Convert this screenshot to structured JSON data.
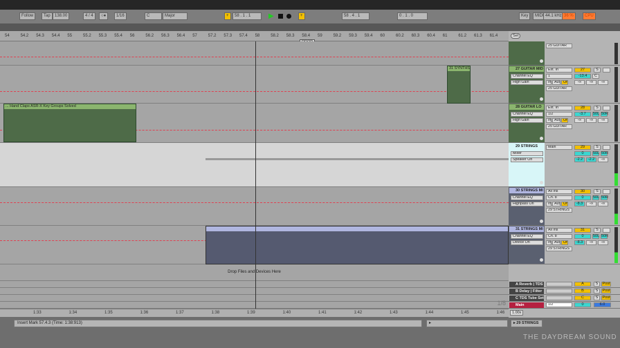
{
  "toolbar": {
    "follow": "Follow",
    "tap": "Tap",
    "tempo": "138.00",
    "signature": "4 / 4",
    "quantize": "1/16",
    "key": "C",
    "scale": "Major",
    "position": "58 .  1 .  1",
    "loop_start": "58 .  4 .  1",
    "loop_length": "0 .  1 .  0",
    "key_map": "Key",
    "midi_map": "MIDI",
    "sample_rate": "44.1 kHz",
    "cpu_percent": "36 %",
    "cpu_label": "CPU"
  },
  "ruler": {
    "ticks": [
      "54",
      "54.2",
      "54.3",
      "54.4",
      "55",
      "55.2",
      "55.3",
      "55.4",
      "56",
      "56.2",
      "56.3",
      "56.4",
      "57",
      "57.2",
      "57.3",
      "57.4",
      "58",
      "58.2",
      "58.3",
      "58.4",
      "59",
      "59.2",
      "59.3",
      "59.4",
      "60",
      "60.2",
      "60.3",
      "60.4",
      "61",
      "61.2",
      "61.3",
      "61.4"
    ],
    "locator": "DROP",
    "set_label": "Set"
  },
  "time_ruler": {
    "ticks": [
      "1:33",
      "1:34",
      "1:35",
      "1:36",
      "1:37",
      "1:38",
      "1:39",
      "1:40",
      "1:41",
      "1:42",
      "1:43",
      "1:44",
      "1:45",
      "1:46"
    ],
    "grid": "1/8"
  },
  "clips": {
    "hand_claps": "... Hand Claps ASR-X Key Groups Solved",
    "synths": "31 SYNTHS 3"
  },
  "drop_hint": "Drop Files and Devices Here",
  "tracks": [
    {
      "name": "",
      "color": "#4e6b48",
      "routing": "25 GUITAR",
      "dev1": "",
      "dev2": ""
    },
    {
      "name": "27 GUITAR MID",
      "color": "#4e6b48",
      "input": "Ext. In",
      "channel": "1",
      "routing": "25 GUITAR",
      "dev1": "Channel EQ",
      "dev2": "High Gain",
      "number": "27",
      "vol": "-13.4",
      "pan": "C",
      "sends": [
        "-∞",
        "-∞",
        "-∞"
      ]
    },
    {
      "name": "28 GUITAR LO",
      "color": "#4e6b48",
      "input": "Ext. In",
      "channel": "1/2",
      "routing": "25 GUITAR",
      "dev1": "Channel EQ",
      "dev2": "High Gain",
      "number": "28",
      "vol": "-3.7",
      "pan": "50L",
      "pan2": "50R",
      "sends": [
        "-∞",
        "-∞",
        "-∞"
      ]
    },
    {
      "name": "29 STRINGS",
      "color": "#d8f6f8",
      "input": "Main",
      "dev1": "Mixer",
      "dev2": "Speaker On",
      "number": "29",
      "vol": "0",
      "pan": "50L",
      "pan2": "50R",
      "sends": [
        "-2.2",
        "-2.2",
        "-∞"
      ]
    },
    {
      "name": "30 STRINGS MI",
      "color": "#5a6070",
      "input": "All Ins",
      "channel": "Ch. 8",
      "routing": "29 STRINGS",
      "dev1": "Channel EQ",
      "dev2": "Highpass On",
      "number": "30",
      "vol": "0",
      "pan": "50L",
      "pan2": "50R",
      "sends": [
        "-8.3",
        "-∞",
        "-∞"
      ]
    },
    {
      "name": "31 STRINGS MI",
      "color": "#5a6070",
      "input": "All Ins",
      "channel": "Ch. 8",
      "routing": "29 STRINGS",
      "dev1": "Channel EQ",
      "dev2": "Device On",
      "number": "31",
      "vol": "0",
      "pan": "50L",
      "pan2": "50R",
      "sends": [
        "-8.3",
        "-∞",
        "-∞"
      ]
    }
  ],
  "monitor": {
    "in": "In",
    "auto": "Auto",
    "off": "Off"
  },
  "returns": [
    {
      "name": "A Reverb | TDS",
      "letter": "A",
      "post": "Post"
    },
    {
      "name": "B Delay | Filter",
      "letter": "B",
      "post": "Post"
    },
    {
      "name": "C TDS Tube Set",
      "letter": "C",
      "post": "Post"
    }
  ],
  "main": {
    "name": "Main",
    "output": "1/2",
    "vol": "0",
    "cue": "6.0"
  },
  "zoom": "1.00x",
  "solo_label": "S",
  "status": {
    "text": "Insert Mark 57.4.3 (Time: 1:38:913)",
    "selected_track": "29 STRINGS"
  },
  "watermark": "THE DAYDREAM SOUND"
}
